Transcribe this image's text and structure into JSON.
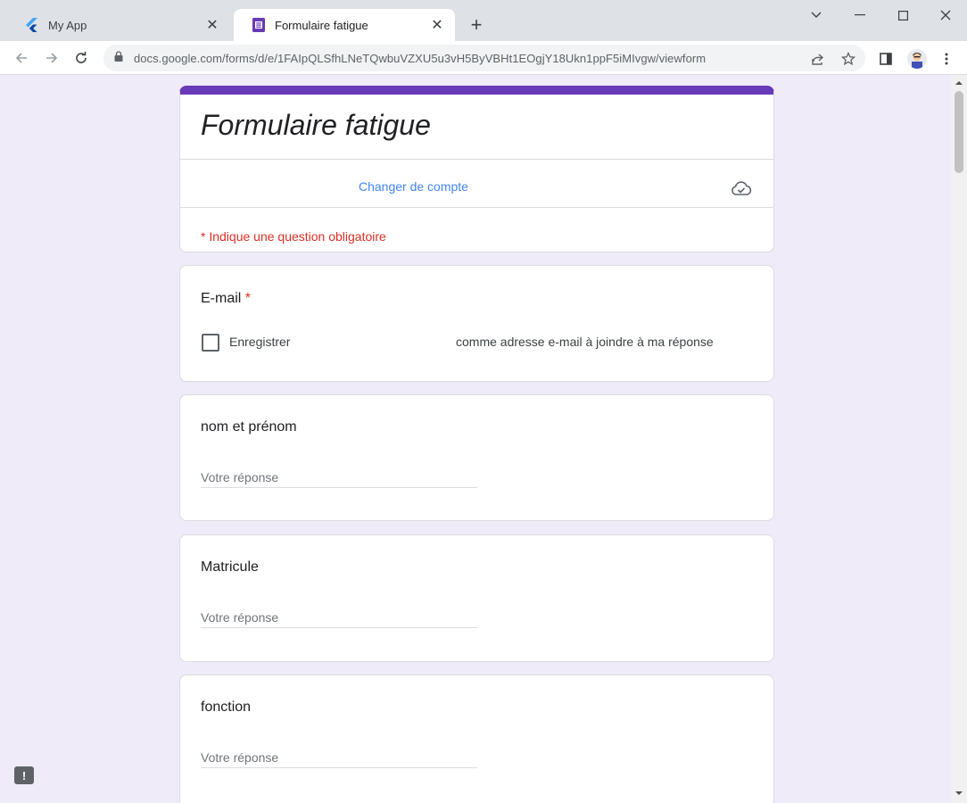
{
  "browser": {
    "tabs": [
      {
        "title": "My App",
        "icon": "flutter-icon"
      },
      {
        "title": "Formulaire fatigue",
        "icon": "google-forms-icon"
      }
    ],
    "close_glyph": "✕",
    "new_tab_glyph": "+",
    "url": "docs.google.com/forms/d/e/1FAIpQLSfhLNeTQwbuVZXU5u3vH5ByVBHt1EOgjY18Ukn1ppF5iMIvgw/viewform"
  },
  "form": {
    "title": "Formulaire fatigue",
    "switch_account": "Changer de compte",
    "required_note": "* Indique une question obligatoire",
    "questions": [
      {
        "title": "E-mail",
        "required_mark": "*",
        "checkbox_label_start": "Enregistrer",
        "checkbox_label_end": "comme adresse e-mail à joindre à ma réponse"
      },
      {
        "title": "nom et prénom",
        "placeholder": "Votre réponse"
      },
      {
        "title": "Matricule",
        "placeholder": "Votre réponse"
      },
      {
        "title": "fonction",
        "placeholder": "Votre réponse"
      }
    ]
  },
  "report_glyph": "!",
  "colors": {
    "accent": "#673ab7",
    "background": "#f0ebf8",
    "required": "#d93025",
    "link": "#4285f4"
  }
}
